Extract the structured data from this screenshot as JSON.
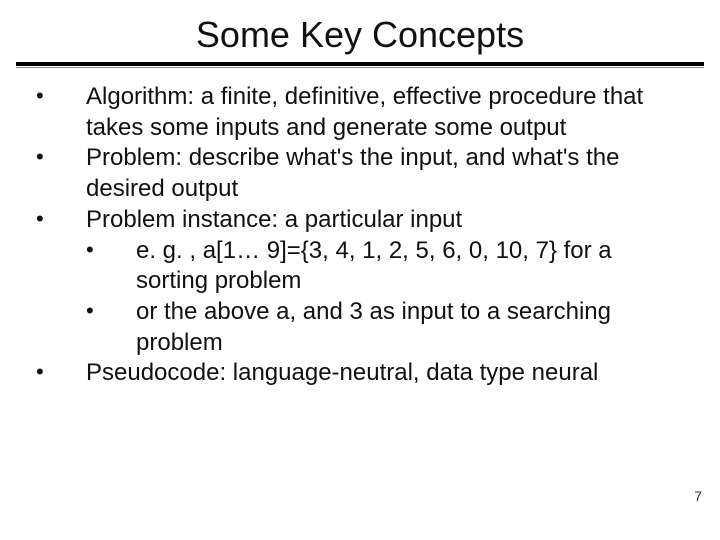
{
  "title": "Some Key Concepts",
  "bullets": {
    "b1": "Algorithm: a finite, definitive, effective procedure that takes some inputs and generate some output",
    "b2": "Problem: describe what's the input, and what's the desired output",
    "b3": "Problem instance: a particular input",
    "b3a": "e. g. , a[1… 9]={3, 4, 1, 2, 5, 6, 0, 10, 7} for a sorting problem",
    "b3b": "or the above a, and 3 as input to a searching problem",
    "b4": "Pseudocode: language-neutral, data type neural"
  },
  "page_number": "7"
}
